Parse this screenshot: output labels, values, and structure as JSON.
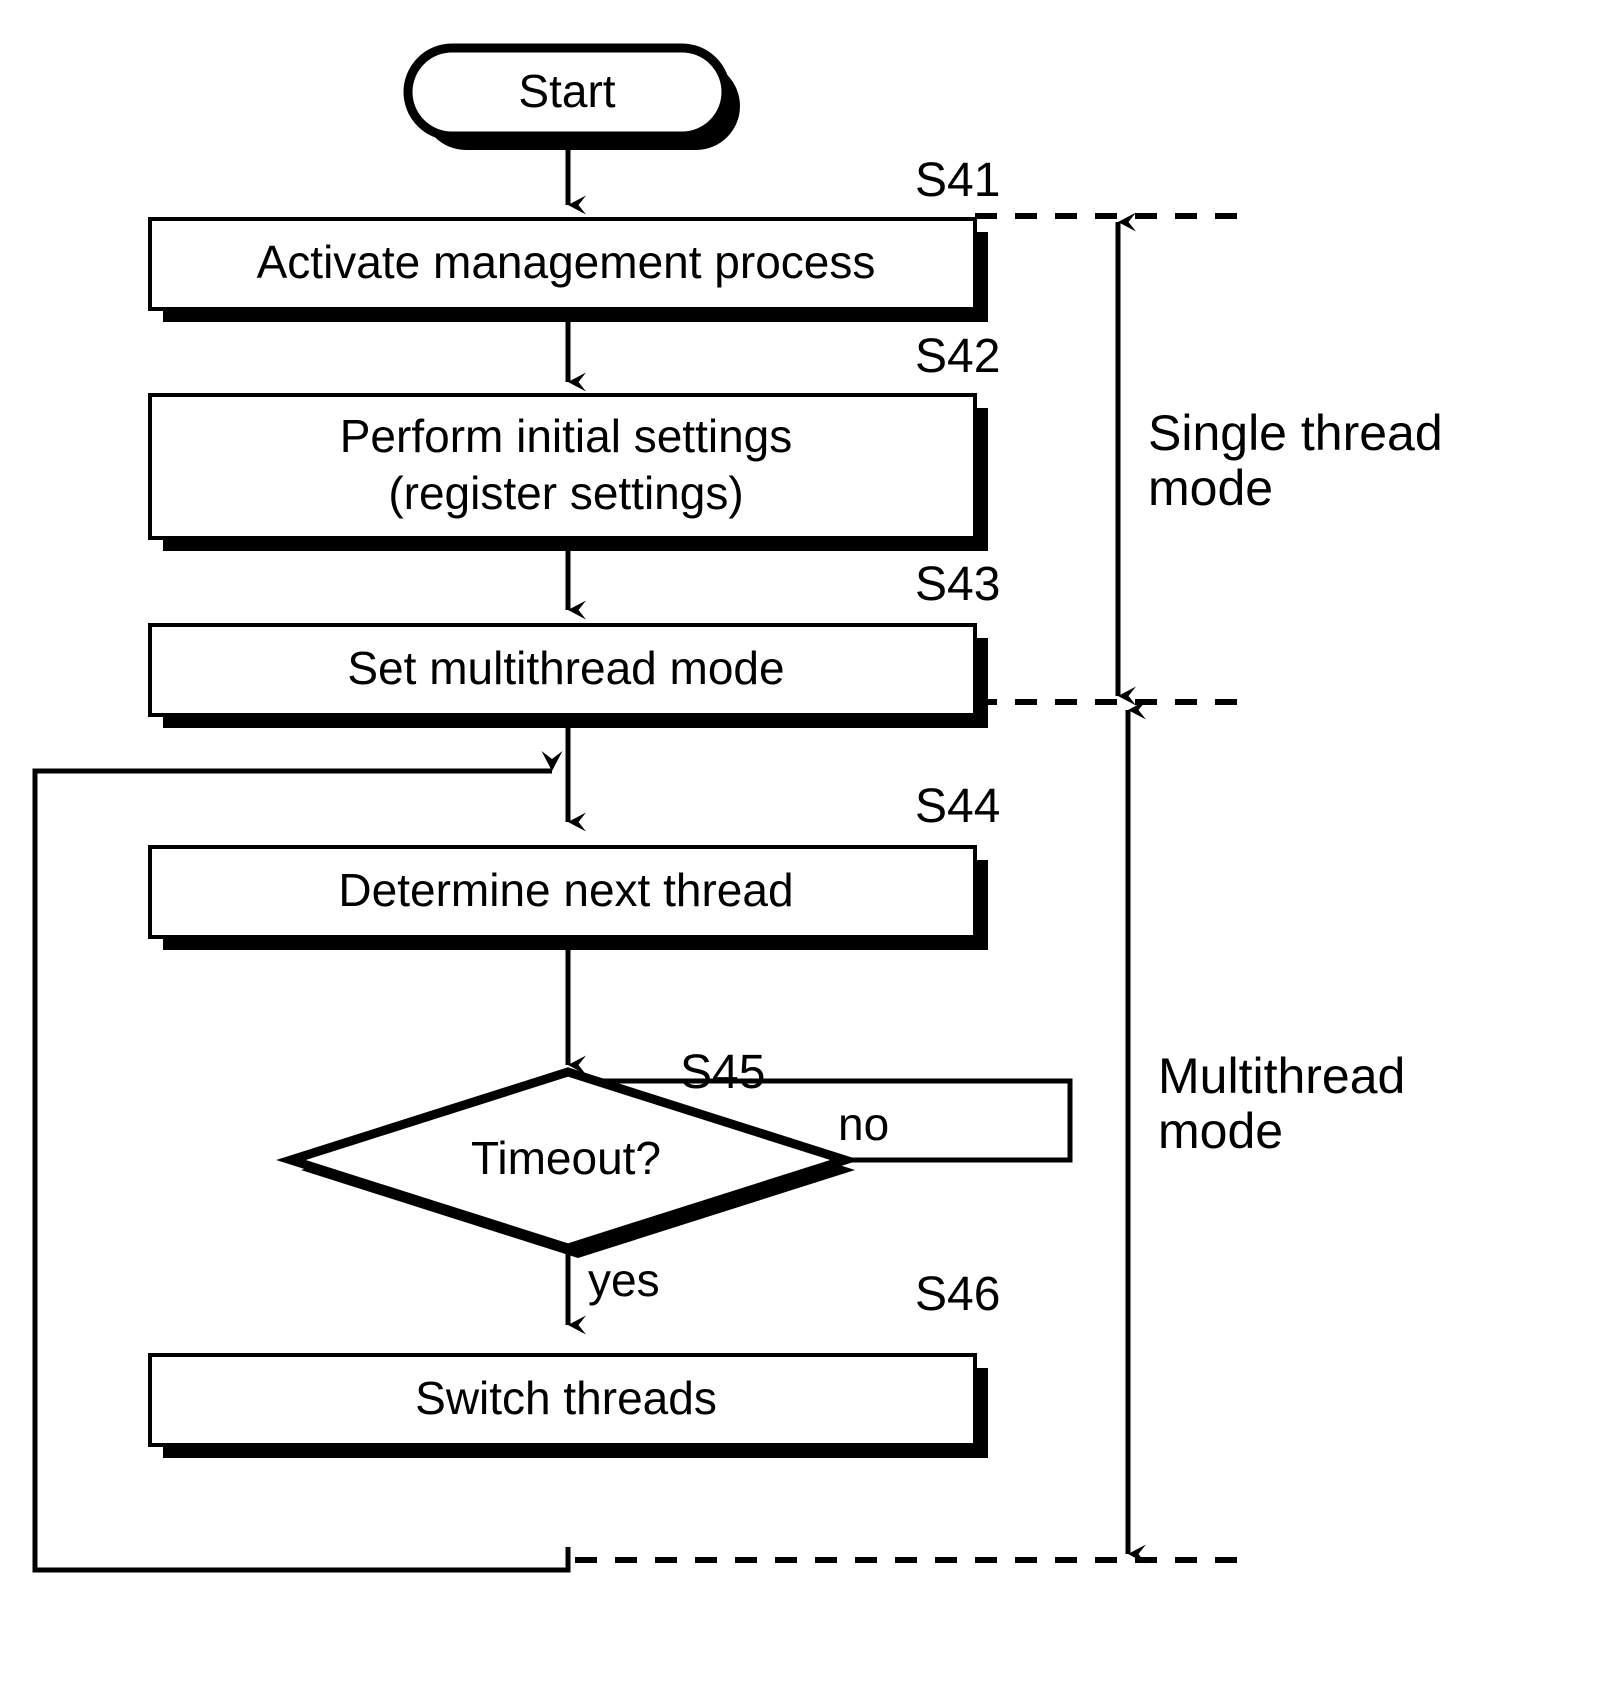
{
  "figure": {
    "type": "flowchart",
    "title": "Thread management process flowchart"
  },
  "nodes": {
    "start": {
      "label": "Start",
      "shape": "terminator"
    },
    "s41": {
      "label": "Activate management process",
      "shape": "process",
      "step": "S41"
    },
    "s42": {
      "label_line1": "Perform initial settings",
      "label_line2": "(register settings)",
      "shape": "process",
      "step": "S42"
    },
    "s43": {
      "label": "Set multithread mode",
      "shape": "process",
      "step": "S43"
    },
    "s44": {
      "label": "Determine next thread",
      "shape": "process",
      "step": "S44"
    },
    "s45": {
      "label": "Timeout?",
      "shape": "decision",
      "step": "S45"
    },
    "s46": {
      "label": "Switch threads",
      "shape": "process",
      "step": "S46"
    }
  },
  "branches": {
    "no": "no",
    "yes": "yes"
  },
  "modes": {
    "single": {
      "line1": "Single thread",
      "line2": "mode"
    },
    "multi": {
      "line1": "Multithread",
      "line2": "mode"
    }
  },
  "colors": {
    "ink": "#000000",
    "paper": "#ffffff"
  }
}
